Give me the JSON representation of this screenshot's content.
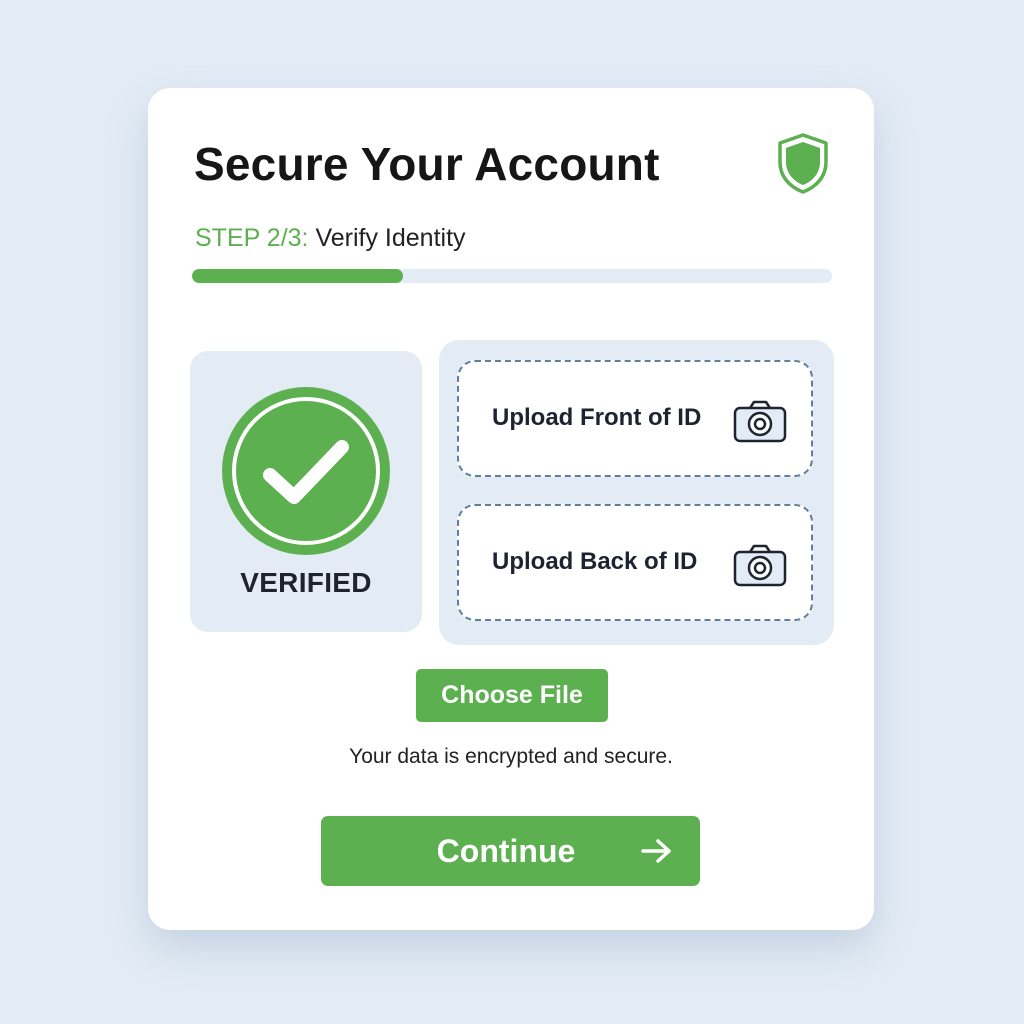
{
  "header": {
    "title": "Secure Your Account",
    "icon": "shield-icon"
  },
  "step": {
    "prefix": "STEP 2/3:",
    "label": "Verify Identity",
    "progress_fraction": 0.33
  },
  "verification": {
    "status_label": "VERIFIED",
    "icon": "check-circle-icon"
  },
  "uploads": [
    {
      "label": "Upload Front of ID",
      "icon": "camera-icon"
    },
    {
      "label": "Upload Back of ID",
      "icon": "camera-icon"
    }
  ],
  "actions": {
    "choose_file_label": "Choose File",
    "security_note": "Your data is encrypted and secure.",
    "continue_label": "Continue",
    "continue_icon": "arrow-right-icon"
  },
  "colors": {
    "accent_green": "#5cb04f",
    "panel_blue": "#e3ecf5",
    "page_background": "#e3ecf5",
    "dash_border": "#5f7f9e",
    "title_text": "#161616"
  }
}
